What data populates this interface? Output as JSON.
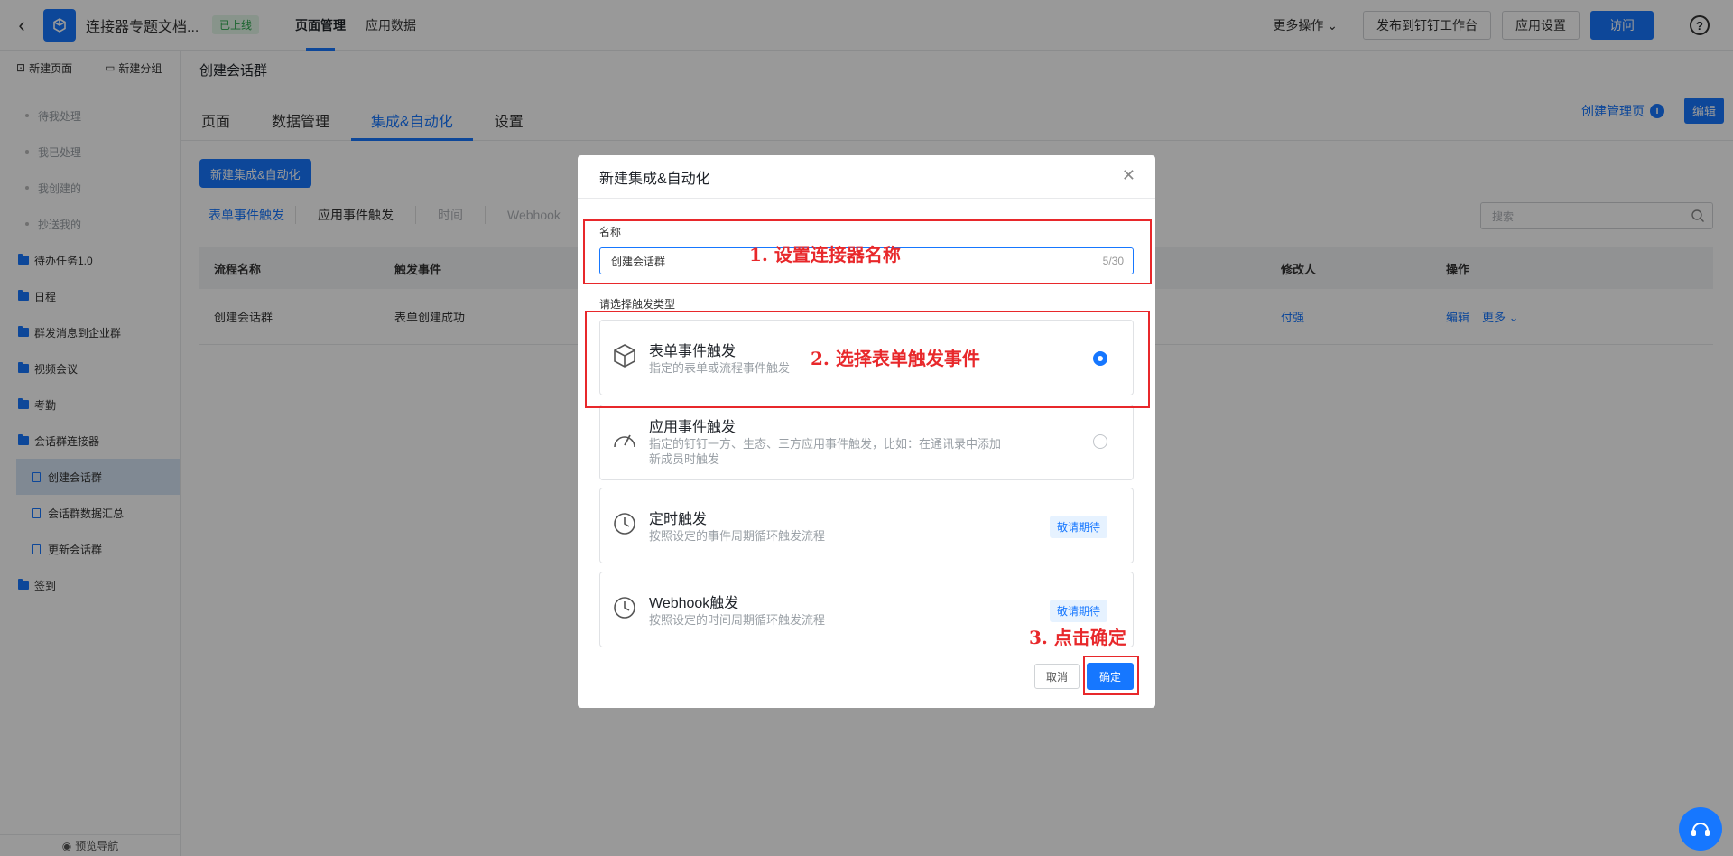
{
  "topbar": {
    "app_title": "连接器专题文档...",
    "status_badge": "已上线",
    "tabs": [
      "页面管理",
      "应用数据"
    ],
    "more_ops": "更多操作",
    "publish_btn": "发布到钉钉工作台",
    "settings_btn": "应用设置",
    "visit_btn": "访问"
  },
  "sidebar": {
    "new_page": "新建页面",
    "new_group": "新建分组",
    "sub_items": [
      "待我处理",
      "我已处理",
      "我创建的",
      "抄送我的"
    ],
    "folders": [
      "待办任务1.0",
      "日程",
      "群发消息到企业群",
      "视频会议",
      "考勤",
      "会话群连接器"
    ],
    "pages": [
      "创建会话群",
      "会话群数据汇总",
      "更新会话群"
    ],
    "last_folder": "签到",
    "preview_nav": "预览导航"
  },
  "main": {
    "page_title": "创建会话群",
    "tabs": [
      "页面",
      "数据管理",
      "集成&自动化",
      "设置"
    ],
    "create_admin_page": "创建管理页",
    "edit_btn": "编辑",
    "new_auto_btn": "新建集成&自动化",
    "filters": [
      "表单事件触发",
      "应用事件触发",
      "时间",
      "Webhook"
    ],
    "search_placeholder": "搜索",
    "table": {
      "headers": [
        "流程名称",
        "触发事件",
        "修改人",
        "操作"
      ],
      "row": {
        "name": "创建会话群",
        "event": "表单创建成功",
        "modifier": "付强",
        "edit": "编辑",
        "more": "更多"
      }
    }
  },
  "modal": {
    "title": "新建集成&自动化",
    "name_label": "名称",
    "name_value": "创建会话群",
    "char_count": "5/30",
    "type_label": "请选择触发类型",
    "cards": [
      {
        "title": "表单事件触发",
        "desc": "指定的表单或流程事件触发",
        "selected": true
      },
      {
        "title": "应用事件触发",
        "desc": "指定的钉钉一方、生态、三方应用事件触发，比如：在通讯录中添加新成员时触发",
        "selected": false
      },
      {
        "title": "定时触发",
        "desc": "按照设定的事件周期循环触发流程",
        "badge": "敬请期待"
      },
      {
        "title": "Webhook触发",
        "desc": "按照设定的时间周期循环触发流程",
        "badge": "敬请期待"
      }
    ],
    "cancel_btn": "取消",
    "ok_btn": "确定"
  },
  "annotations": {
    "step1": "1. 设置连接器名称",
    "step2": "2. 选择表单触发事件",
    "step3": "3. 点击确定"
  },
  "colors": {
    "primary": "#1677ff",
    "annotation_red": "#e8282b",
    "online_green": "#2fa84f"
  }
}
